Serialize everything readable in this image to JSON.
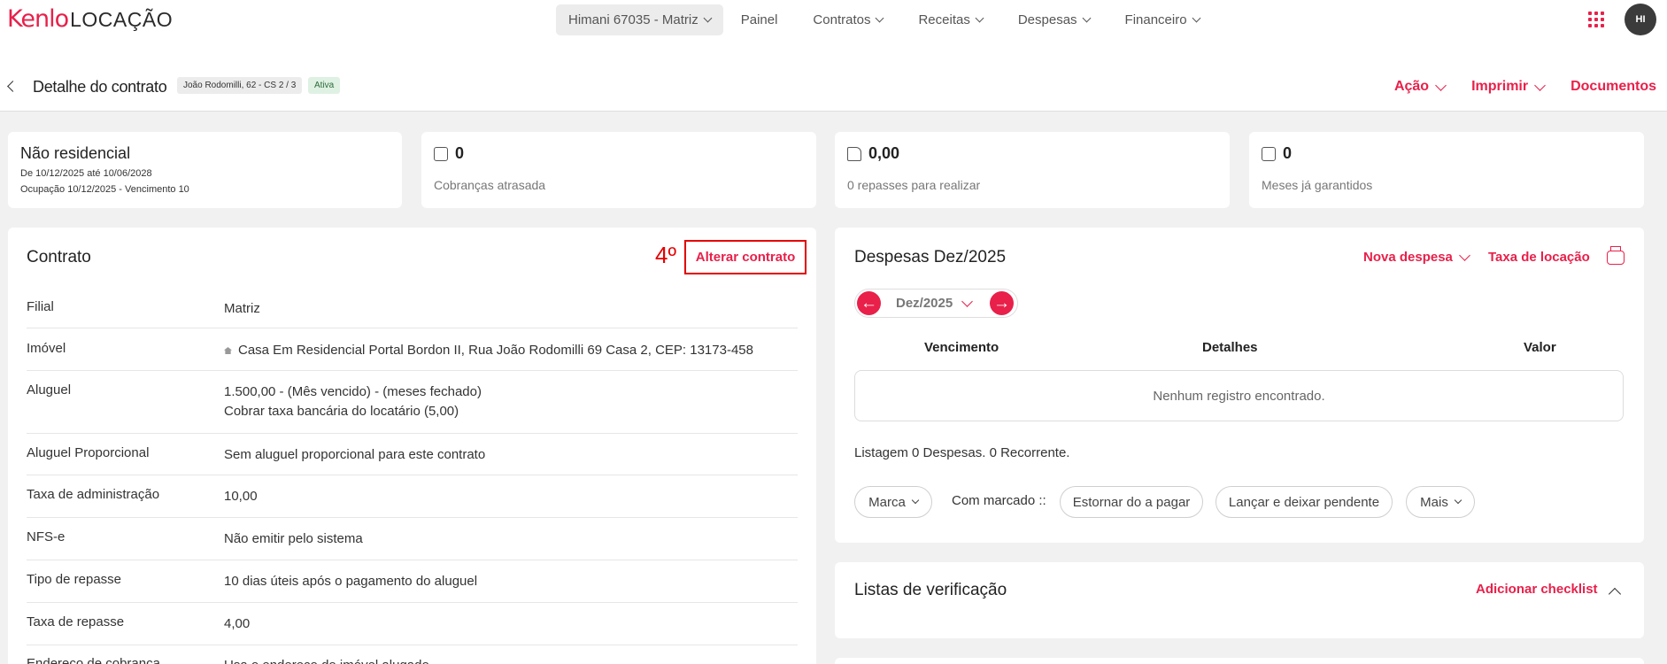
{
  "brand": {
    "logo_main": "Kenlo",
    "logo_sub": "LOCAÇÃO",
    "accent": "#e8204a"
  },
  "nav": {
    "branch": "Himani 67035 - Matriz",
    "items": [
      "Painel",
      "Contratos",
      "Receitas",
      "Despesas",
      "Financeiro"
    ]
  },
  "user": {
    "initials": "HI"
  },
  "header": {
    "title": "Detalhe do contrato",
    "address_chip": "João Rodomilli, 62 - CS 2 / 3",
    "status": "Ativa",
    "actions": {
      "acao": "Ação",
      "imprimir": "Imprimir",
      "documentos": "Documentos"
    }
  },
  "summary": {
    "type": "Não residencial",
    "period": "De 10/12/2025 até 10/06/2028",
    "occupation": "Ocupação 10/12/2025 - Vencimento 10",
    "late_count": "0",
    "late_label": "Cobranças atrasada",
    "transfers_value": "0,00",
    "transfers_label": "0 repasses para realizar",
    "months_value": "0",
    "months_label": "Meses já garantidos"
  },
  "contract": {
    "title": "Contrato",
    "step_mark": "4º",
    "edit_label": "Alterar contrato",
    "rows": [
      {
        "label": "Filial",
        "value": "Matriz"
      },
      {
        "label": "Imóvel",
        "value": "Casa Em Residencial Portal Bordon II, Rua João Rodomilli 69 Casa 2, CEP: 13173-458"
      },
      {
        "label": "Aluguel",
        "value": "1.500,00 - (Mês vencido) - (meses fechado)",
        "value2": "Cobrar taxa bancária do locatário (5,00)"
      },
      {
        "label": "Aluguel Proporcional",
        "value": "Sem aluguel proporcional para este contrato"
      },
      {
        "label": "Taxa de administração",
        "value": "10,00"
      },
      {
        "label": "NFS-e",
        "value": "Não emitir pelo sistema"
      },
      {
        "label": "Tipo de repasse",
        "value": "10 dias úteis após o pagamento do aluguel"
      },
      {
        "label": "Taxa de repasse",
        "value": "4,00"
      },
      {
        "label": "Endereço de cobrança",
        "value": "Usa o endereço do imóvel alugado"
      }
    ]
  },
  "expenses": {
    "title": "Despesas Dez/2025",
    "new_label": "Nova despesa",
    "tax_label": "Taxa de locação",
    "month": "Dez/2025",
    "columns": [
      "Vencimento",
      "Detalhes",
      "Valor"
    ],
    "empty": "Nenhum registro encontrado.",
    "listing": "Listagem 0 Despesas. 0 Recorrente.",
    "mark_label": "Marca",
    "with_marked": "Com marcado ::",
    "reverse_label": "Estornar do a pagar",
    "launch_label": "Lançar e deixar pendente",
    "more_label": "Mais"
  },
  "checklists": {
    "title": "Listas de verificação",
    "add_label": "Adicionar checklist"
  }
}
